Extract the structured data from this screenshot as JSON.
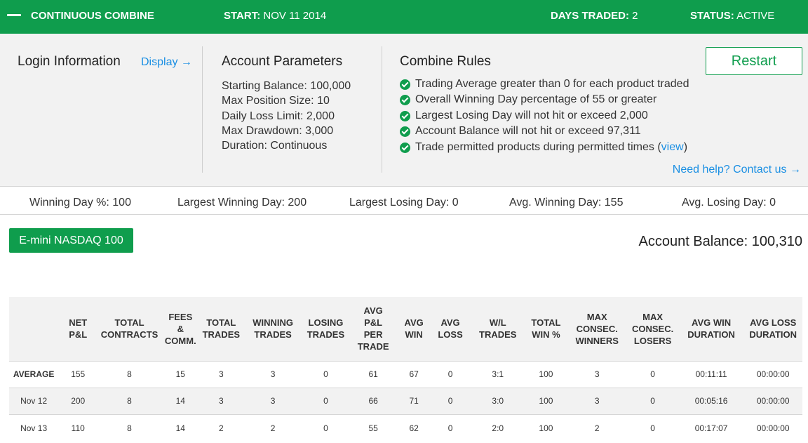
{
  "topbar": {
    "title": "CONTINUOUS COMBINE",
    "start_label": "START:",
    "start_value": "NOV 11 2014",
    "days_label": "DAYS TRADED:",
    "days_value": "2",
    "status_label": "STATUS:",
    "status_value": "ACTIVE"
  },
  "login": {
    "title": "Login Information",
    "display_link": "Display →"
  },
  "params": {
    "title": "Account Parameters",
    "items": [
      "Starting Balance: 100,000",
      "Max Position Size: 10",
      "Daily Loss Limit: 2,000",
      "Max Drawdown: 3,000",
      "Duration: Continuous"
    ]
  },
  "rules": {
    "title": "Combine Rules",
    "items": [
      "Trading Average greater than 0 for each product traded",
      "Overall Winning Day percentage of 55 or greater",
      "Largest Losing Day will not hit or exceed 2,000",
      "Account Balance will not hit or exceed 97,311",
      "Trade permitted products during permitted times ("
    ],
    "view_link": "view",
    "close_paren": ")",
    "restart_button": "Restart",
    "help_link": "Need help? Contact us →"
  },
  "stats": {
    "winning_day_pct": "Winning Day %: 100",
    "largest_winning_day": "Largest Winning Day: 200",
    "largest_losing_day": "Largest Losing Day: 0",
    "avg_winning_day": "Avg. Winning Day: 155",
    "avg_losing_day": "Avg. Losing Day: 0"
  },
  "product_button": "E-mini NASDAQ 100",
  "account_balance": "Account Balance: 100,310",
  "colors": {
    "brand_green": "#0f9d4d",
    "link_blue": "#1a8fe3",
    "panel_gray": "#f2f2f2"
  },
  "table": {
    "headers": [
      "",
      "NET\nP&L",
      "TOTAL\nCONTRACTS",
      "FEES\n&\nCOMM.",
      "TOTAL\nTRADES",
      "WINNING\nTRADES",
      "LOSING\nTRADES",
      "AVG\nP&L\nPER\nTRADE",
      "AVG\nWIN",
      "AVG\nLOSS",
      "W/L\nTRADES",
      "TOTAL\nWIN %",
      "MAX\nCONSEC.\nWINNERS",
      "MAX\nCONSEC.\nLOSERS",
      "AVG WIN\nDURATION",
      "AVG LOSS\nDURATION"
    ],
    "rows": [
      [
        "AVERAGE",
        "155",
        "8",
        "15",
        "3",
        "3",
        "0",
        "61",
        "67",
        "0",
        "3:1",
        "100",
        "3",
        "0",
        "00:11:11",
        "00:00:00"
      ],
      [
        "Nov 12",
        "200",
        "8",
        "14",
        "3",
        "3",
        "0",
        "66",
        "71",
        "0",
        "3:0",
        "100",
        "3",
        "0",
        "00:05:16",
        "00:00:00"
      ],
      [
        "Nov 13",
        "110",
        "8",
        "14",
        "2",
        "2",
        "0",
        "55",
        "62",
        "0",
        "2:0",
        "100",
        "2",
        "0",
        "00:17:07",
        "00:00:00"
      ]
    ]
  }
}
